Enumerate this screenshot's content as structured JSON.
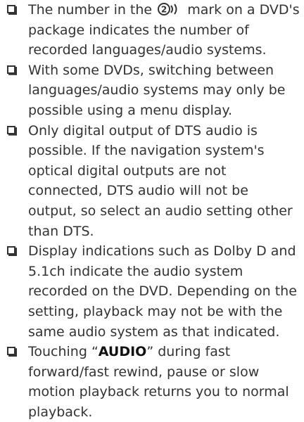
{
  "notes": [
    {
      "before_mark": "The number in the ",
      "mark_number": "2",
      "mark_icon": "audio-languages-mark-icon",
      "after_mark": " mark on a DVD's package indicates the number of recorded languages/audio systems."
    },
    {
      "text": "With some DVDs, switching between languages/audio systems may only be possible using a menu display."
    },
    {
      "text": "Only digital output of DTS audio is possible. If the navigation system's optical digital outputs are not connected, DTS audio will not be output, so select an audio setting other than DTS."
    },
    {
      "text": "Display indications such as Dolby D and 5.1ch indicate the audio system recorded on the DVD. Depending on the setting, playback may not be with the same audio system as that indicated."
    },
    {
      "open_quote": "“",
      "bold": "AUDIO",
      "close_quote": "”",
      "before_bold": "Touching ",
      "after_bold": " during fast forward/fast rewind, pause or slow motion playback returns you to normal playback."
    }
  ]
}
